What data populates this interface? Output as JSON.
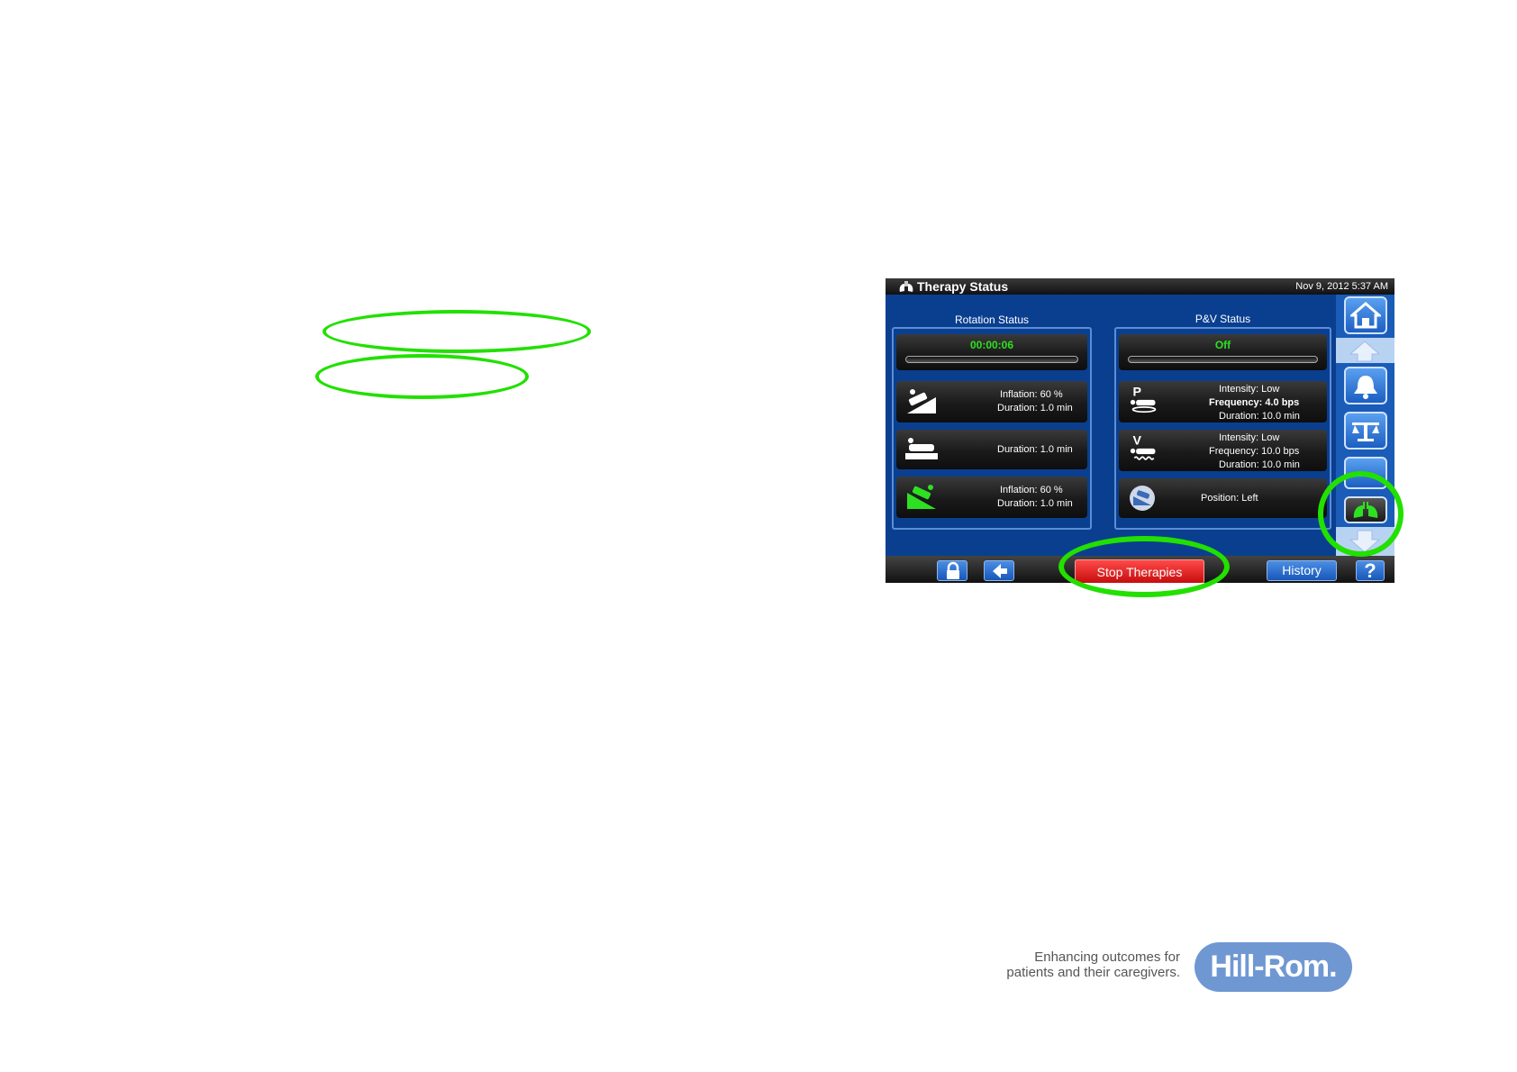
{
  "screen": {
    "title": "Therapy Status",
    "datetime": "Nov 9, 2012 5:37 AM"
  },
  "rotation": {
    "title": "Rotation Status",
    "timer": "00:00:06",
    "tiles": [
      {
        "icon": "rotate-right-patient-icon",
        "line1": "Inflation: 60 %",
        "line2": "Duration: 1.0 min"
      },
      {
        "icon": "flat-patient-icon",
        "line1": "Duration: 1.0 min"
      },
      {
        "icon": "rotate-left-patient-icon-green",
        "line1": "Inflation: 60 %",
        "line2": "Duration: 1.0 min"
      }
    ]
  },
  "pv": {
    "title": "P&V Status",
    "status": "Off",
    "percussion": {
      "icon": "percussion-p-icon",
      "intensity": "Intensity: Low",
      "frequency": "Frequency: 4.0 bps",
      "duration": "Duration: 10.0 min"
    },
    "vibration": {
      "icon": "vibration-v-icon",
      "intensity": "Intensity: Low",
      "frequency": "Frequency: 10.0 bps",
      "duration": "Duration: 10.0 min"
    },
    "position": {
      "icon": "patient-position-icon",
      "text": "Position:  Left"
    }
  },
  "bottom": {
    "stop_label": "Stop Therapies",
    "history_label": "History",
    "help_label": "?"
  },
  "sidebar": [
    "home-icon",
    "up-arrow-icon",
    "bell-icon",
    "scale-icon",
    "blank-button",
    "lungs-therapy-icon",
    "down-arrow-icon"
  ],
  "branding": {
    "tagline_line1": "Enhancing outcomes for",
    "tagline_line2": "patients and their caregivers.",
    "logo": "Hill-Rom."
  },
  "colors": {
    "accent_green": "#22e000",
    "stop_red": "#e01b1b",
    "screen_blue": "#0a3d8c"
  }
}
